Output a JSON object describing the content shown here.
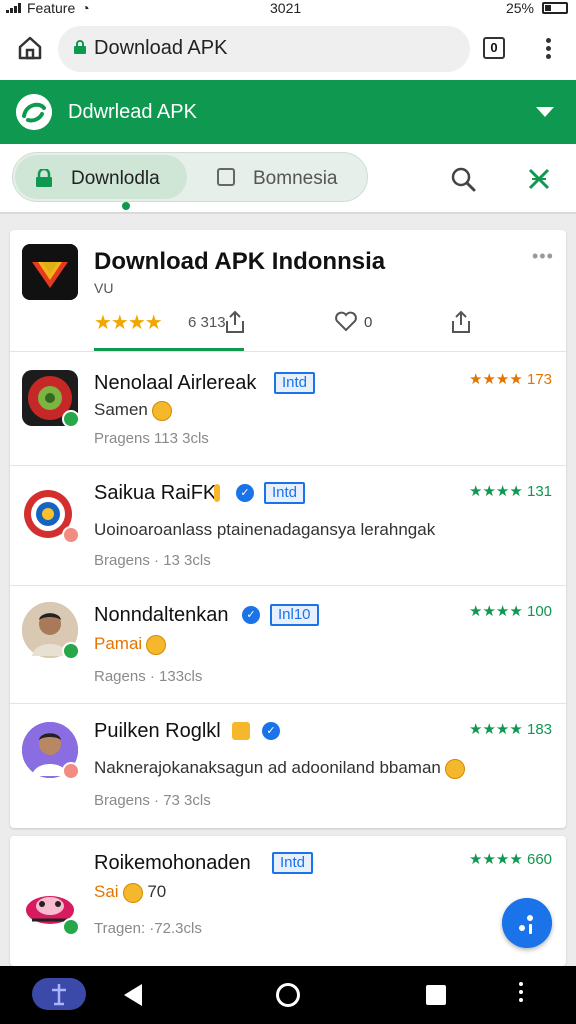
{
  "status_bar": {
    "carrier": "Feature",
    "time": "3021",
    "battery": "25%"
  },
  "browser": {
    "url": "Download APK",
    "tab_count": "0"
  },
  "banner": {
    "title": "Ddwrlead APK"
  },
  "filters": {
    "tab1": "Downlodla",
    "tab2": "Bomnesia"
  },
  "hero": {
    "title": "Download APK  Indonnsia",
    "subtitle": "VU",
    "stars": "★★★★",
    "count": "6 313",
    "likes": "0"
  },
  "apps": [
    {
      "name": "Nenolaal Airlereak",
      "badge": "Intd",
      "rating": "★★★★ 173",
      "sub": "Samen",
      "meta": "Pragens 113 3cls"
    },
    {
      "name": "Saikua RaiFK",
      "badge": "Intd",
      "rating": "★★★★ 131",
      "sub": "Uoinoaroanlass ptainenadagansya lerahngak",
      "meta": "Bragens · 13 3cls"
    },
    {
      "name": "Nonndaltenkan",
      "badge": "Inl10",
      "rating": "★★★★ 100",
      "sub": "Pamai",
      "meta": "Ragens · 133cls"
    },
    {
      "name": "Puilken Roglkl",
      "rating": "★★★★ 183",
      "sub": "Naknerajokanaksagun ad adooniland bbaman",
      "meta": "Bragens · 73 3cls"
    },
    {
      "name": "Roikemohonaden",
      "badge": "Intd",
      "rating": "★★★★ 660",
      "sub": "Sai",
      "sub_extra": "70",
      "meta": "Tragen: ·72.3cls"
    }
  ],
  "colors": {
    "brand_green": "#0f9850",
    "link_blue": "#1a73e8",
    "star_orange": "#f0a800"
  }
}
